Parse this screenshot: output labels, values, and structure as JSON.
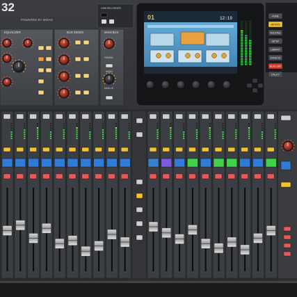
{
  "brand": {
    "model": "32",
    "tagline": "POWERED BY MIDAS"
  },
  "top_panel": {
    "usb_label": "USB RECORDER",
    "sections": [
      "EQUALIZER",
      "BUS SENDS",
      "MAIN BUS"
    ],
    "main_bus_labels": [
      "PAN/BAL",
      "MONO",
      "MAIN LR"
    ]
  },
  "screen": {
    "channel": "01",
    "time": "12:19"
  },
  "view_buttons": [
    "HOME",
    "METERS",
    "ROUTING",
    "SETUP",
    "LIBRARY",
    "EFFECTS",
    "MUTE GRP",
    "UTILITY"
  ],
  "colors": {
    "chassis": "#2b2d30",
    "panel": "#45484c",
    "screen": "#5aa8d8",
    "accent_red": "#d43a2a",
    "accent_yellow": "#f1c232",
    "meter_green": "#3ad04a"
  },
  "strip_banks": [
    {
      "name": "input-bank-left",
      "lcd_colors": [
        "#2f7bd6",
        "#2f7bd6",
        "#2f7bd6",
        "#2f7bd6",
        "#2f7bd6",
        "#2f7bd6",
        "#2f7bd6",
        "#2f7bd6",
        "#2f7bd6",
        "#2f7bd6"
      ],
      "fader_levels": [
        0.55,
        0.62,
        0.45,
        0.58,
        0.38,
        0.42,
        0.28,
        0.35,
        0.5,
        0.4
      ]
    },
    {
      "name": "input-bank-right",
      "lcd_colors": [
        "#3a7ed0",
        "#7b5ae0",
        "#2f7bd6",
        "#3fd24a",
        "#2f7bd6",
        "#3fd24a",
        "#3fd24a",
        "#2f7bd6",
        "#2f7bd6",
        "#3fd24a"
      ],
      "fader_levels": [
        0.6,
        0.52,
        0.44,
        0.56,
        0.38,
        0.32,
        0.4,
        0.3,
        0.45,
        0.55
      ]
    }
  ]
}
